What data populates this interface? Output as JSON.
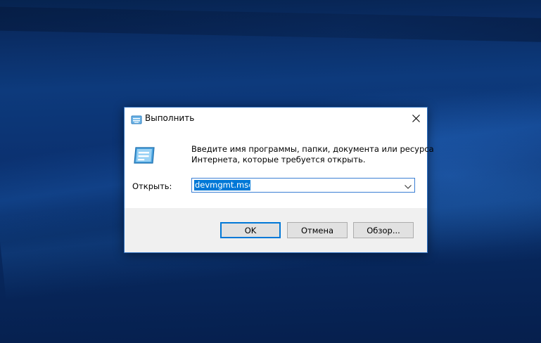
{
  "dialog": {
    "title": "Выполнить",
    "description_line1": "Введите имя программы, папки, документа или ресурса",
    "description_line2": "Интернета, которые требуется открыть.",
    "open_label": "Открыть:",
    "open_value": "devmgmt.msc",
    "buttons": {
      "ok": "OK",
      "cancel": "Отмена",
      "browse": "Обзор..."
    }
  },
  "icons": {
    "title": "run-icon",
    "content": "run-icon",
    "close": "close-icon",
    "dropdown": "chevron-down-icon"
  },
  "colors": {
    "selection": "#0078d7",
    "dialog_border": "#2d6fbf",
    "footer_bg": "#f0f0f0",
    "desktop": "#0b3170"
  }
}
